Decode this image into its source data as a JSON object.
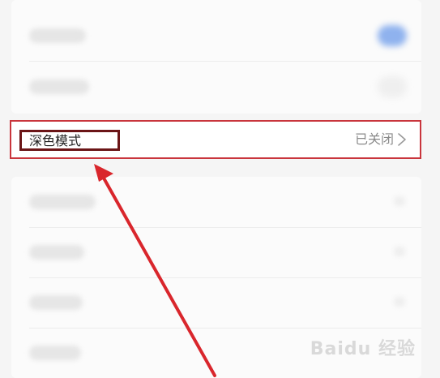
{
  "dark_mode_row": {
    "label": "深色模式",
    "value": "已关闭"
  },
  "colors": {
    "highlight_border": "#c9353c",
    "label_box_border": "#6b1517",
    "arrow": "#d9262c",
    "toggle_on": "#8fb2ee"
  },
  "icons": {
    "row_chevron": "chevron-right-icon",
    "annotation": "arrow-up-icon"
  },
  "watermark": "Baidu 经验"
}
